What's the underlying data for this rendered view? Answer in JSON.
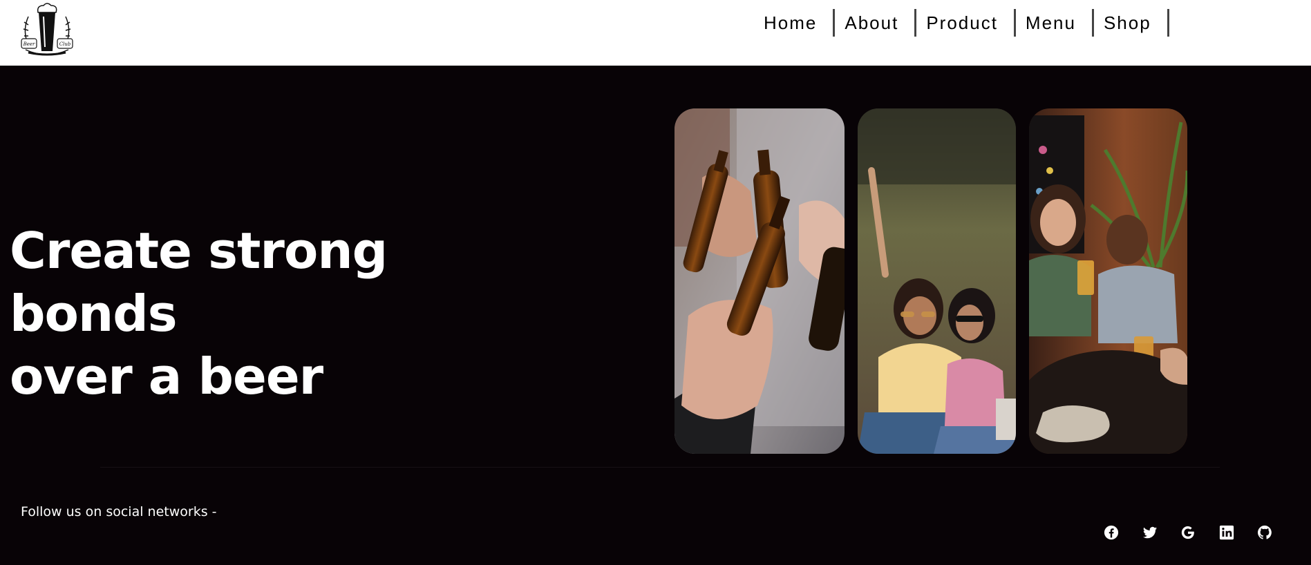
{
  "nav": {
    "logo_icon": "beer-club-logo",
    "logo_text": [
      "Beer",
      "Club"
    ],
    "items": [
      {
        "label": "Home"
      },
      {
        "label": "About"
      },
      {
        "label": "Product"
      },
      {
        "label": "Menu"
      },
      {
        "label": "Shop"
      }
    ]
  },
  "hero": {
    "title_line1": "Create strong bonds",
    "title_line2": "over a beer",
    "images": [
      {
        "icon": "photo-friends-toasting-beer-bottles"
      },
      {
        "icon": "photo-two-women-celebrating-outdoors"
      },
      {
        "icon": "photo-friends-with-beer-glasses-at-table"
      }
    ]
  },
  "footer": {
    "follow_text": "Follow us on social networks -",
    "social": [
      {
        "icon": "facebook-icon"
      },
      {
        "icon": "twitter-icon"
      },
      {
        "icon": "google-icon"
      },
      {
        "icon": "linkedin-icon"
      },
      {
        "icon": "github-icon"
      }
    ]
  },
  "colors": {
    "background": "#080306",
    "navbar": "#ffffff",
    "text": "#ffffff"
  }
}
